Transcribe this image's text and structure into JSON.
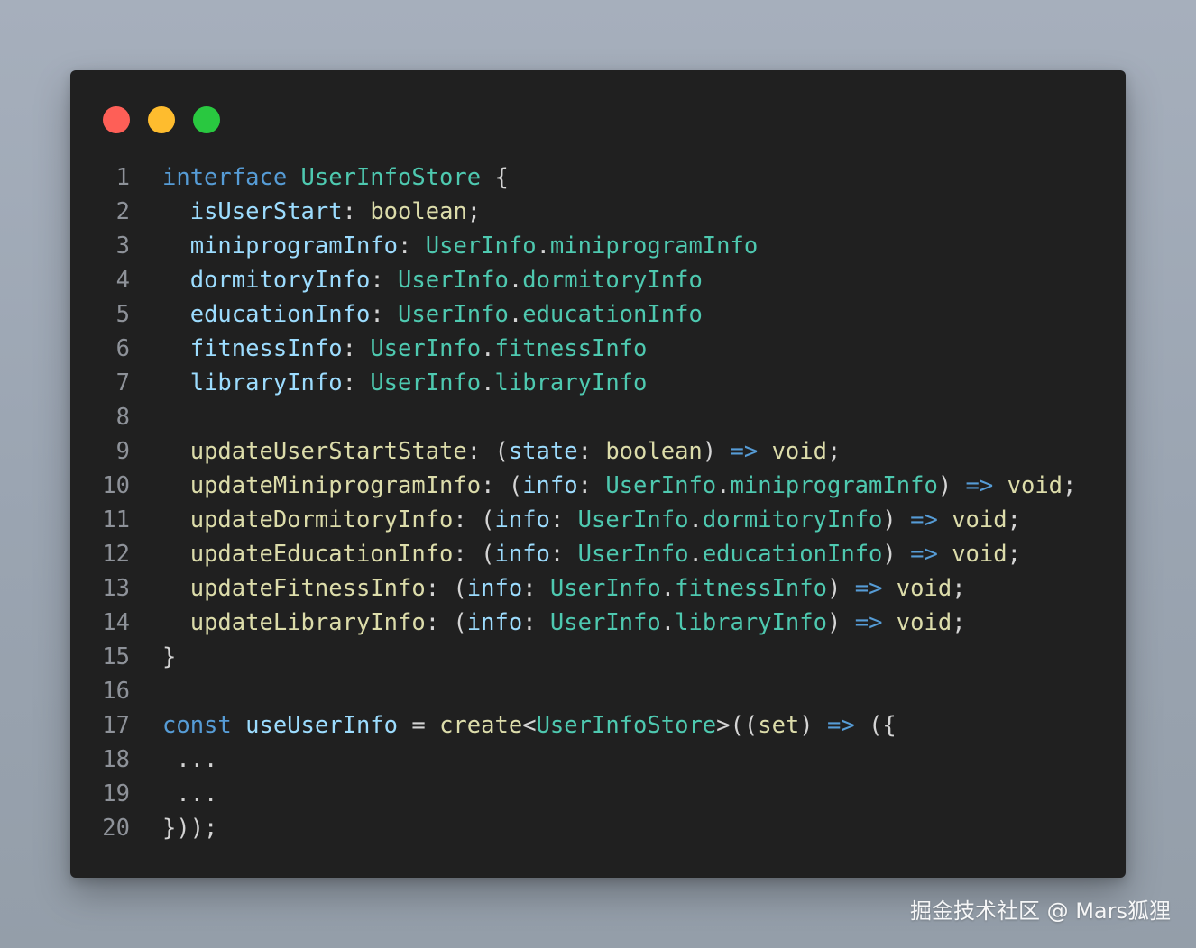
{
  "window": {
    "controls": [
      {
        "name": "close",
        "color": "#fe5f57"
      },
      {
        "name": "minimize",
        "color": "#febc2e"
      },
      {
        "name": "maximize",
        "color": "#29c840"
      }
    ]
  },
  "code": {
    "lines": [
      {
        "num": "1",
        "tokens": [
          {
            "t": "interface",
            "c": "kw"
          },
          {
            "t": " ",
            "c": "pu"
          },
          {
            "t": "UserInfoStore",
            "c": "ty"
          },
          {
            "t": " {",
            "c": "pu"
          }
        ]
      },
      {
        "num": "2",
        "tokens": [
          {
            "t": "  ",
            "c": "pu"
          },
          {
            "t": "isUserStart",
            "c": "pr"
          },
          {
            "t": ": ",
            "c": "pu"
          },
          {
            "t": "boolean",
            "c": "fn"
          },
          {
            "t": ";",
            "c": "pu"
          }
        ]
      },
      {
        "num": "3",
        "tokens": [
          {
            "t": "  ",
            "c": "pu"
          },
          {
            "t": "miniprogramInfo",
            "c": "pr"
          },
          {
            "t": ": ",
            "c": "pu"
          },
          {
            "t": "UserInfo",
            "c": "ty"
          },
          {
            "t": ".",
            "c": "pu"
          },
          {
            "t": "miniprogramInfo",
            "c": "ty"
          }
        ]
      },
      {
        "num": "4",
        "tokens": [
          {
            "t": "  ",
            "c": "pu"
          },
          {
            "t": "dormitoryInfo",
            "c": "pr"
          },
          {
            "t": ": ",
            "c": "pu"
          },
          {
            "t": "UserInfo",
            "c": "ty"
          },
          {
            "t": ".",
            "c": "pu"
          },
          {
            "t": "dormitoryInfo",
            "c": "ty"
          }
        ]
      },
      {
        "num": "5",
        "tokens": [
          {
            "t": "  ",
            "c": "pu"
          },
          {
            "t": "educationInfo",
            "c": "pr"
          },
          {
            "t": ": ",
            "c": "pu"
          },
          {
            "t": "UserInfo",
            "c": "ty"
          },
          {
            "t": ".",
            "c": "pu"
          },
          {
            "t": "educationInfo",
            "c": "ty"
          }
        ]
      },
      {
        "num": "6",
        "tokens": [
          {
            "t": "  ",
            "c": "pu"
          },
          {
            "t": "fitnessInfo",
            "c": "pr"
          },
          {
            "t": ": ",
            "c": "pu"
          },
          {
            "t": "UserInfo",
            "c": "ty"
          },
          {
            "t": ".",
            "c": "pu"
          },
          {
            "t": "fitnessInfo",
            "c": "ty"
          }
        ]
      },
      {
        "num": "7",
        "tokens": [
          {
            "t": "  ",
            "c": "pu"
          },
          {
            "t": "libraryInfo",
            "c": "pr"
          },
          {
            "t": ": ",
            "c": "pu"
          },
          {
            "t": "UserInfo",
            "c": "ty"
          },
          {
            "t": ".",
            "c": "pu"
          },
          {
            "t": "libraryInfo",
            "c": "ty"
          }
        ]
      },
      {
        "num": "8",
        "tokens": []
      },
      {
        "num": "9",
        "tokens": [
          {
            "t": "  ",
            "c": "pu"
          },
          {
            "t": "updateUserStartState",
            "c": "fn"
          },
          {
            "t": ": (",
            "c": "pu"
          },
          {
            "t": "state",
            "c": "pr"
          },
          {
            "t": ": ",
            "c": "pu"
          },
          {
            "t": "boolean",
            "c": "fn"
          },
          {
            "t": ") ",
            "c": "pu"
          },
          {
            "t": "=>",
            "c": "kw"
          },
          {
            "t": " ",
            "c": "pu"
          },
          {
            "t": "void",
            "c": "fn"
          },
          {
            "t": ";",
            "c": "pu"
          }
        ]
      },
      {
        "num": "10",
        "tokens": [
          {
            "t": "  ",
            "c": "pu"
          },
          {
            "t": "updateMiniprogramInfo",
            "c": "fn"
          },
          {
            "t": ": (",
            "c": "pu"
          },
          {
            "t": "info",
            "c": "pr"
          },
          {
            "t": ": ",
            "c": "pu"
          },
          {
            "t": "UserInfo",
            "c": "ty"
          },
          {
            "t": ".",
            "c": "pu"
          },
          {
            "t": "miniprogramInfo",
            "c": "ty"
          },
          {
            "t": ") ",
            "c": "pu"
          },
          {
            "t": "=>",
            "c": "kw"
          },
          {
            "t": " ",
            "c": "pu"
          },
          {
            "t": "void",
            "c": "fn"
          },
          {
            "t": ";",
            "c": "pu"
          }
        ]
      },
      {
        "num": "11",
        "tokens": [
          {
            "t": "  ",
            "c": "pu"
          },
          {
            "t": "updateDormitoryInfo",
            "c": "fn"
          },
          {
            "t": ": (",
            "c": "pu"
          },
          {
            "t": "info",
            "c": "pr"
          },
          {
            "t": ": ",
            "c": "pu"
          },
          {
            "t": "UserInfo",
            "c": "ty"
          },
          {
            "t": ".",
            "c": "pu"
          },
          {
            "t": "dormitoryInfo",
            "c": "ty"
          },
          {
            "t": ") ",
            "c": "pu"
          },
          {
            "t": "=>",
            "c": "kw"
          },
          {
            "t": " ",
            "c": "pu"
          },
          {
            "t": "void",
            "c": "fn"
          },
          {
            "t": ";",
            "c": "pu"
          }
        ]
      },
      {
        "num": "12",
        "tokens": [
          {
            "t": "  ",
            "c": "pu"
          },
          {
            "t": "updateEducationInfo",
            "c": "fn"
          },
          {
            "t": ": (",
            "c": "pu"
          },
          {
            "t": "info",
            "c": "pr"
          },
          {
            "t": ": ",
            "c": "pu"
          },
          {
            "t": "UserInfo",
            "c": "ty"
          },
          {
            "t": ".",
            "c": "pu"
          },
          {
            "t": "educationInfo",
            "c": "ty"
          },
          {
            "t": ") ",
            "c": "pu"
          },
          {
            "t": "=>",
            "c": "kw"
          },
          {
            "t": " ",
            "c": "pu"
          },
          {
            "t": "void",
            "c": "fn"
          },
          {
            "t": ";",
            "c": "pu"
          }
        ]
      },
      {
        "num": "13",
        "tokens": [
          {
            "t": "  ",
            "c": "pu"
          },
          {
            "t": "updateFitnessInfo",
            "c": "fn"
          },
          {
            "t": ": (",
            "c": "pu"
          },
          {
            "t": "info",
            "c": "pr"
          },
          {
            "t": ": ",
            "c": "pu"
          },
          {
            "t": "UserInfo",
            "c": "ty"
          },
          {
            "t": ".",
            "c": "pu"
          },
          {
            "t": "fitnessInfo",
            "c": "ty"
          },
          {
            "t": ") ",
            "c": "pu"
          },
          {
            "t": "=>",
            "c": "kw"
          },
          {
            "t": " ",
            "c": "pu"
          },
          {
            "t": "void",
            "c": "fn"
          },
          {
            "t": ";",
            "c": "pu"
          }
        ]
      },
      {
        "num": "14",
        "tokens": [
          {
            "t": "  ",
            "c": "pu"
          },
          {
            "t": "updateLibraryInfo",
            "c": "fn"
          },
          {
            "t": ": (",
            "c": "pu"
          },
          {
            "t": "info",
            "c": "pr"
          },
          {
            "t": ": ",
            "c": "pu"
          },
          {
            "t": "UserInfo",
            "c": "ty"
          },
          {
            "t": ".",
            "c": "pu"
          },
          {
            "t": "libraryInfo",
            "c": "ty"
          },
          {
            "t": ") ",
            "c": "pu"
          },
          {
            "t": "=>",
            "c": "kw"
          },
          {
            "t": " ",
            "c": "pu"
          },
          {
            "t": "void",
            "c": "fn"
          },
          {
            "t": ";",
            "c": "pu"
          }
        ]
      },
      {
        "num": "15",
        "tokens": [
          {
            "t": "}",
            "c": "pu"
          }
        ]
      },
      {
        "num": "16",
        "tokens": []
      },
      {
        "num": "17",
        "tokens": [
          {
            "t": "const",
            "c": "kw"
          },
          {
            "t": " ",
            "c": "pu"
          },
          {
            "t": "useUserInfo",
            "c": "pr"
          },
          {
            "t": " = ",
            "c": "pu"
          },
          {
            "t": "create",
            "c": "fn"
          },
          {
            "t": "<",
            "c": "pu"
          },
          {
            "t": "UserInfoStore",
            "c": "ty"
          },
          {
            "t": ">((",
            "c": "pu"
          },
          {
            "t": "set",
            "c": "fn"
          },
          {
            "t": ") ",
            "c": "pu"
          },
          {
            "t": "=>",
            "c": "kw"
          },
          {
            "t": " ({",
            "c": "pu"
          }
        ]
      },
      {
        "num": "18",
        "tokens": [
          {
            "t": " ...",
            "c": "pu"
          }
        ]
      },
      {
        "num": "19",
        "tokens": [
          {
            "t": " ...",
            "c": "pu"
          }
        ]
      },
      {
        "num": "20",
        "tokens": [
          {
            "t": "}));",
            "c": "pu"
          }
        ]
      }
    ]
  },
  "watermark": "掘金技术社区 @ Mars狐狸"
}
